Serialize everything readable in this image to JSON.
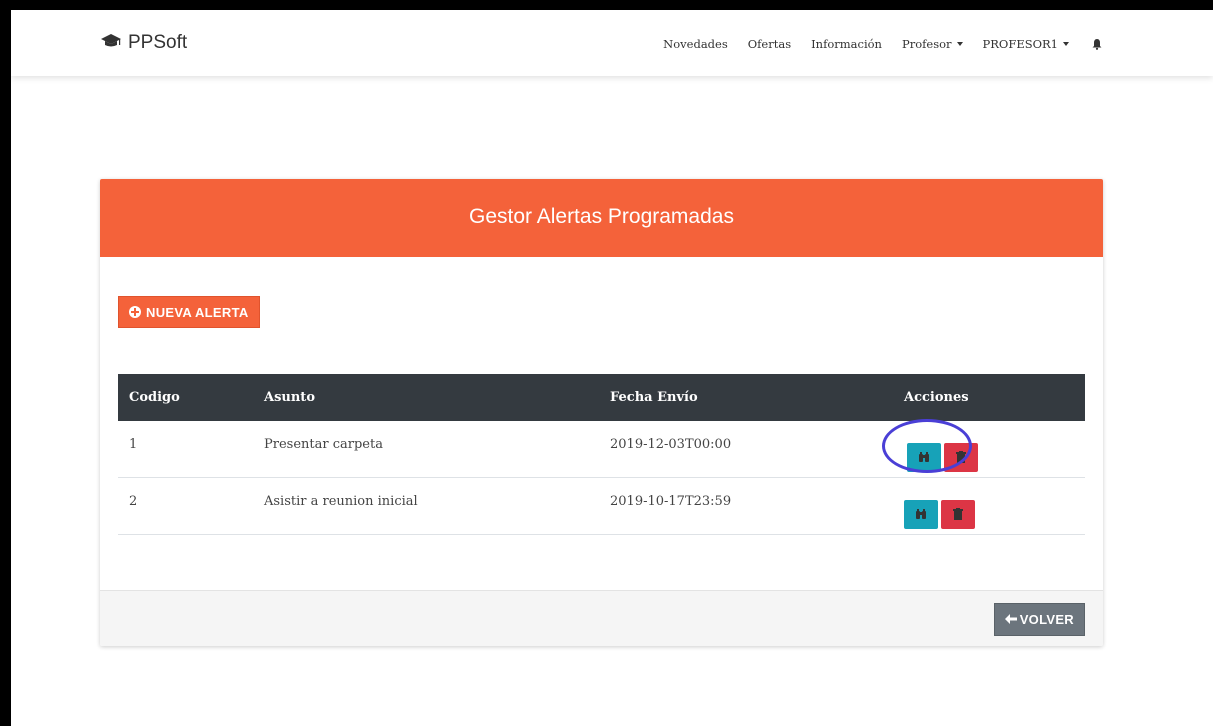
{
  "navbar": {
    "brand": "PPSoft",
    "items": [
      {
        "label": "Novedades"
      },
      {
        "label": "Ofertas"
      },
      {
        "label": "Información"
      },
      {
        "label": "Profesor"
      },
      {
        "label": "PROFESOR1"
      }
    ],
    "icons": {
      "brand": "graduation-cap-icon",
      "notifications": "bell-icon"
    }
  },
  "card": {
    "title": "Gestor Alertas Programadas",
    "new_button": "NUEVA ALERTA",
    "back_button": "VOLVER"
  },
  "table": {
    "headers": [
      "Codigo",
      "Asunto",
      "Fecha Envío",
      "Acciones"
    ],
    "rows": [
      {
        "codigo": "1",
        "asunto": "Presentar carpeta",
        "fecha": "2019-12-03T00:00"
      },
      {
        "codigo": "2",
        "asunto": "Asistir a reunion inicial",
        "fecha": "2019-10-17T23:59"
      }
    ]
  },
  "colors": {
    "accent": "#f4623a",
    "table_header": "#343a40",
    "view": "#17a2b8",
    "delete": "#dc3545",
    "back": "#6c757d",
    "highlight": "#4a3fd6"
  }
}
